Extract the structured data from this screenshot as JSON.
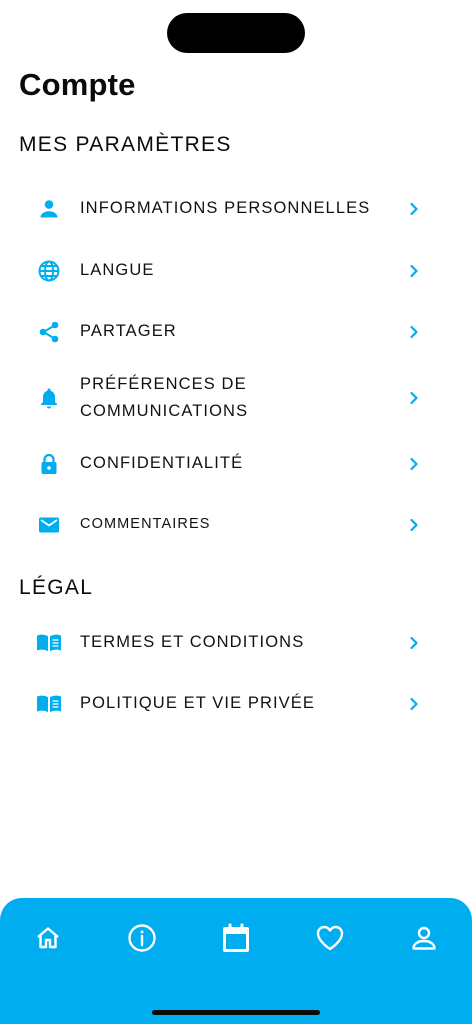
{
  "page": {
    "title": "Compte"
  },
  "colors": {
    "accent": "#00AEEF",
    "text": "#0B0B0B",
    "background": "#FFFFFF",
    "tab_icon": "#FFFFFF"
  },
  "settings_section": {
    "title": "MES PARAMÈTRES",
    "items": [
      {
        "label": "INFORMATIONS PERSONNELLES",
        "icon": "person-icon"
      },
      {
        "label": "LANGUE",
        "icon": "globe-icon"
      },
      {
        "label": "PARTAGER",
        "icon": "share-icon"
      },
      {
        "label": "PRÉFÉRENCES DE COMMUNICATIONS",
        "icon": "bell-icon"
      },
      {
        "label": "CONFIDENTIALITÉ",
        "icon": "lock-icon"
      },
      {
        "label": "COMMENTAIRES",
        "icon": "mail-icon"
      }
    ]
  },
  "legal_section": {
    "title": "LÉGAL",
    "items": [
      {
        "label": "TERMES ET CONDITIONS",
        "icon": "book-icon"
      },
      {
        "label": "POLITIQUE ET VIE PRIVÉE",
        "icon": "book-icon"
      }
    ]
  },
  "tab_bar": {
    "tabs": [
      {
        "icon": "home-icon"
      },
      {
        "icon": "info-icon"
      },
      {
        "icon": "calendar-icon"
      },
      {
        "icon": "heart-icon"
      },
      {
        "icon": "profile-icon"
      }
    ]
  }
}
